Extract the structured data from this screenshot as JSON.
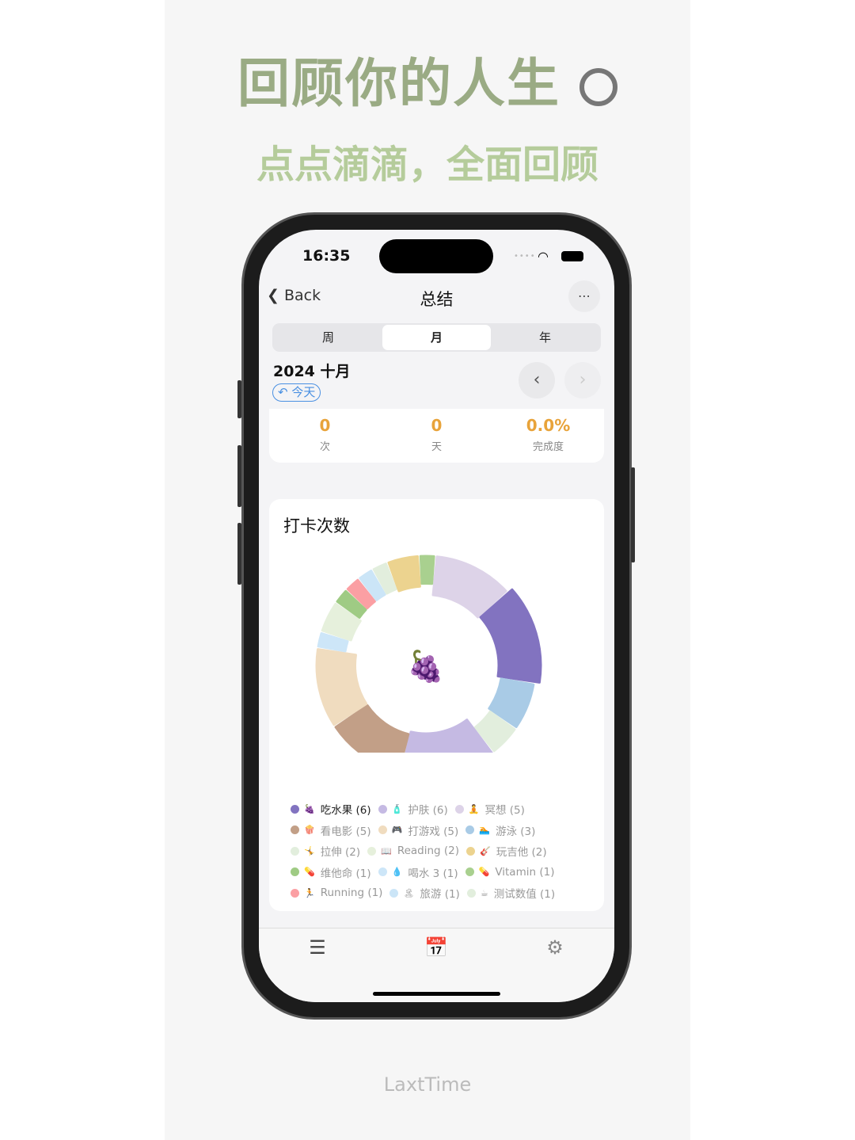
{
  "promo": {
    "headline": "回顾你的人生",
    "subheadline": "点点滴滴，全面回顾",
    "footer": "LaxtTime",
    "headline_icon": "pie-chart-icon"
  },
  "status_bar": {
    "time": "16:35"
  },
  "nav": {
    "back_label": "Back",
    "title": "总结",
    "more_icon": "ellipsis-circle-icon"
  },
  "segments": [
    {
      "label": "周",
      "selected": false
    },
    {
      "label": "月",
      "selected": true
    },
    {
      "label": "年",
      "selected": false
    }
  ],
  "period": {
    "label": "2024 十月",
    "today_label": "今天"
  },
  "stats": [
    {
      "value": "0",
      "label": "次"
    },
    {
      "value": "0",
      "label": "天"
    },
    {
      "value": "0.0%",
      "label": "完成度"
    }
  ],
  "chart_data": {
    "type": "pie",
    "title": "打卡次数",
    "center_emoji": "🍇",
    "selected": "吃水果",
    "slices": [
      {
        "name": "冥想",
        "value": 5,
        "color": "#ddd3e8"
      },
      {
        "name": "吃水果",
        "value": 6,
        "color": "#8273c0"
      },
      {
        "name": "游泳",
        "value": 3,
        "color": "#a9cbe6"
      },
      {
        "name": "拉伸",
        "value": 2,
        "color": "#e2eedd"
      },
      {
        "name": "护肤",
        "value": 6,
        "color": "#c5bae3"
      },
      {
        "name": "看电影",
        "value": 5,
        "color": "#c29f87"
      },
      {
        "name": "打游戏",
        "value": 5,
        "color": "#f0dcbf"
      },
      {
        "name": "喝水 3",
        "value": 1,
        "color": "#cde6f8"
      },
      {
        "name": "Reading",
        "value": 2,
        "color": "#e6f0dc"
      },
      {
        "name": "维他命",
        "value": 1,
        "color": "#9fcb84"
      },
      {
        "name": "Running",
        "value": 1,
        "color": "#fb9fa3"
      },
      {
        "name": "旅游",
        "value": 1,
        "color": "#cbe5f7"
      },
      {
        "name": "测试数值",
        "value": 1,
        "color": "#e2eedd"
      },
      {
        "name": "玩吉他",
        "value": 2,
        "color": "#ecd38f"
      },
      {
        "name": "Vitamin",
        "value": 1,
        "color": "#a9d08f"
      }
    ]
  },
  "legend": [
    [
      {
        "text": "吃水果 (6)",
        "emoji": "🍇",
        "color": "#8273c0",
        "sel": true
      },
      {
        "text": "护肤 (6)",
        "emoji": "🧴",
        "color": "#c5bae3"
      },
      {
        "text": "冥想 (5)",
        "emoji": "🧘",
        "color": "#ddd3e8"
      }
    ],
    [
      {
        "text": "看电影 (5)",
        "emoji": "🍿",
        "color": "#c29f87"
      },
      {
        "text": "打游戏 (5)",
        "emoji": "🎮",
        "color": "#f0dcbf"
      },
      {
        "text": "游泳 (3)",
        "emoji": "🏊",
        "color": "#a9cbe6"
      }
    ],
    [
      {
        "text": "拉伸 (2)",
        "emoji": "🤸",
        "color": "#e2eedd"
      },
      {
        "text": "Reading (2)",
        "emoji": "📖",
        "color": "#e6f0dc"
      },
      {
        "text": "玩吉他 (2)",
        "emoji": "🎸",
        "color": "#ecd38f"
      }
    ],
    [
      {
        "text": "维他命 (1)",
        "emoji": "💊",
        "color": "#9fcb84"
      },
      {
        "text": "喝水 3 (1)",
        "emoji": "💧",
        "color": "#cde6f8"
      },
      {
        "text": "Vitamin (1)",
        "emoji": "💊",
        "color": "#a9d08f"
      }
    ],
    [
      {
        "text": "Running (1)",
        "emoji": "🏃",
        "color": "#fb9fa3"
      },
      {
        "text": "旅游 (1)",
        "emoji": "🏝",
        "color": "#cbe5f7"
      },
      {
        "text": "测试数值 (1)",
        "emoji": "☕",
        "color": "#e2eedd"
      }
    ]
  ],
  "tabbar": [
    {
      "icon": "list-icon"
    },
    {
      "icon": "calendar-check-icon"
    },
    {
      "icon": "gear-icon"
    }
  ]
}
